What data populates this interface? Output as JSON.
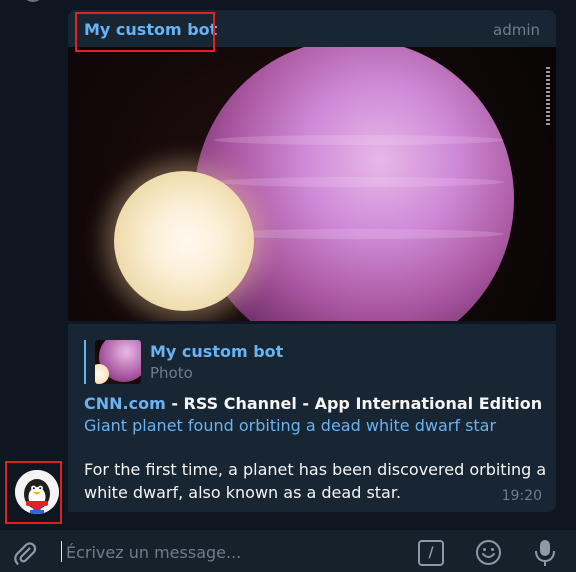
{
  "message": {
    "sender": "My custom bot",
    "sender_role": "admin",
    "quote": {
      "name": "My custom bot",
      "type": "Photo"
    },
    "source_site": "CNN.com",
    "source_separator": " - ",
    "source_channel": "RSS Channel - App International Edition",
    "headline": "Giant planet found orbiting a dead white dwarf star",
    "body_line1": "For the first time, a planet has been discovered orbiting a",
    "body_line2": "white dwarf, also known as a dead star.",
    "time": "19:20"
  },
  "input": {
    "placeholder": "Écrivez un message..."
  },
  "colors": {
    "background": "#0e1621",
    "bubble": "#182533",
    "accent_blue": "#6ab3f3",
    "highlight_red": "#e3201f"
  },
  "icons": {
    "attach": "paperclip-icon",
    "command": "bot-command-icon",
    "emoji": "emoji-icon",
    "voice": "microphone-icon"
  }
}
